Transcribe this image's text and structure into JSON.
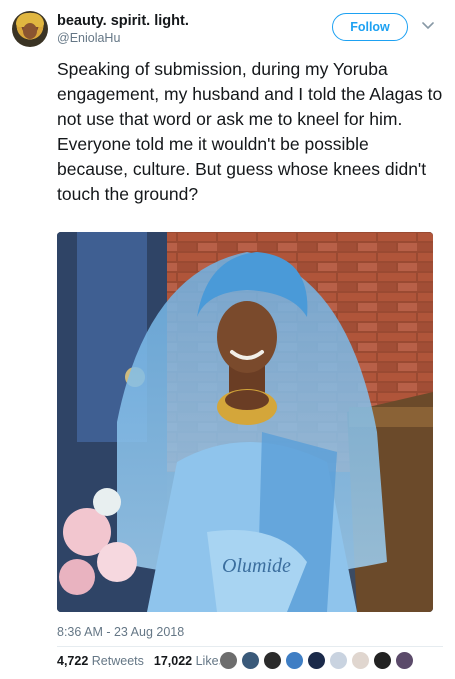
{
  "author": {
    "display_name": "beauty. spirit. light.",
    "handle": "@EniolaHu"
  },
  "follow_label": "Follow",
  "tweet_text": "Speaking of submission, during my Yoruba engagement, my husband and I told the Alagas to not use that word or ask me to kneel for him. Everyone told me it wouldn't be possible because, culture. But guess whose knees didn't touch the ground?",
  "photo": {
    "caption_on_image": "Olumide"
  },
  "timestamp": "8:36 AM - 23 Aug 2018",
  "stats": {
    "retweets_count": "4,722",
    "retweets_label": "Retweets",
    "likes_count": "17,022",
    "likes_label": "Likes"
  },
  "likers": [
    {
      "icon": "avatar",
      "color": "#6d6d6d"
    },
    {
      "icon": "avatar",
      "color": "#3a5a7a"
    },
    {
      "icon": "avatar",
      "color": "#2b2b2b"
    },
    {
      "icon": "avatar",
      "color": "#3f7ec4"
    },
    {
      "icon": "avatar",
      "color": "#1b2a4a"
    },
    {
      "icon": "avatar",
      "color": "#c9d3e0"
    },
    {
      "icon": "avatar",
      "color": "#e0d6cf"
    },
    {
      "icon": "avatar",
      "color": "#222222"
    },
    {
      "icon": "avatar",
      "color": "#5b4a6a"
    }
  ],
  "colors": {
    "accent": "#1da1f2",
    "secondary_text": "#657786",
    "primary_text": "#14171a"
  }
}
